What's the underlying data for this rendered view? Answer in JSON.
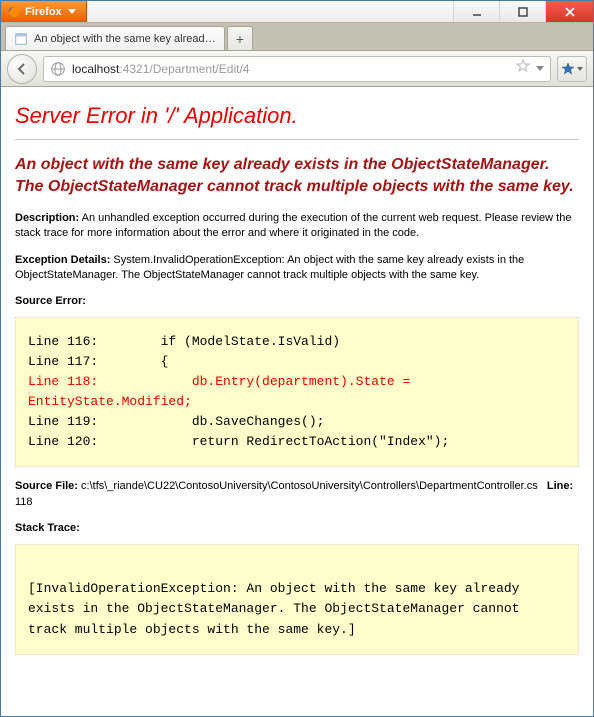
{
  "window": {
    "app_name": "Firefox",
    "tab_title": "An object with the same key already exis..."
  },
  "nav": {
    "url_host": "localhost",
    "url_path": ":4321/Department/Edit/4"
  },
  "error": {
    "heading": "Server Error in '/' Application.",
    "subheading": "An object with the same key already exists in the ObjectStateManager. The ObjectStateManager cannot track multiple objects with the same key.",
    "description_label": "Description:",
    "description_text": " An unhandled exception occurred during the execution of the current web request. Please review the stack trace for more information about the error and where it originated in the code.",
    "exception_label": "Exception Details:",
    "exception_text": " System.InvalidOperationException: An object with the same key already exists in the ObjectStateManager. The ObjectStateManager cannot track multiple objects with the same key.",
    "source_error_label": "Source Error:",
    "code": {
      "l116": "Line 116:        if (ModelState.IsValid)",
      "l117": "Line 117:        {",
      "l118": "Line 118:            db.Entry(department).State = EntityState.Modified;",
      "l119": "Line 119:            db.SaveChanges();",
      "l120": "Line 120:            return RedirectToAction(\"Index\");"
    },
    "source_file_label": "Source File:",
    "source_file_path": " c:\\tfs\\_riande\\CU22\\ContosoUniversity\\ContosoUniversity\\Controllers\\DepartmentController.cs",
    "line_label": "Line:",
    "line_number": " 118",
    "stack_trace_label": "Stack Trace:",
    "stack_trace_text": "[InvalidOperationException: An object with the same key already exists in the ObjectStateManager. The ObjectStateManager cannot track multiple objects with the same key.]"
  }
}
